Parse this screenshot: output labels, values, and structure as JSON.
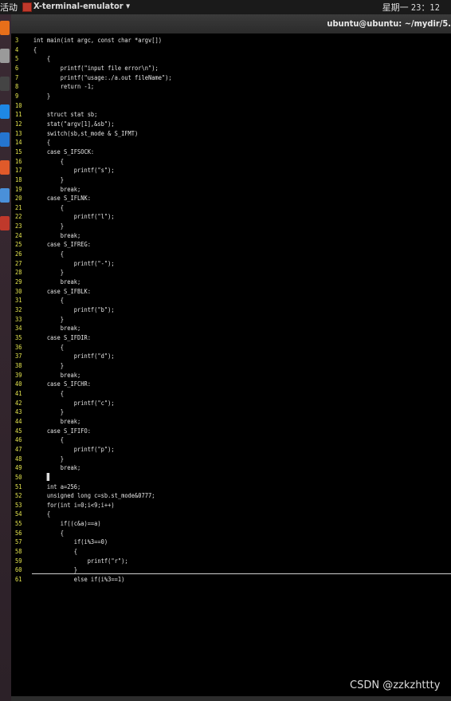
{
  "topbar": {
    "activities": "活动",
    "app_name": "X-terminal-emulator ▾",
    "clock": "星期一 23：12"
  },
  "window": {
    "title": "ubuntu@ubuntu: ~/mydir/5."
  },
  "dock": {
    "icons": [
      {
        "name": "firefox-icon",
        "color": "#e76f1a"
      },
      {
        "name": "files-icon",
        "color": "#9a9a9a"
      },
      {
        "name": "terminal-icon",
        "color": "#444444"
      },
      {
        "name": "vscode-icon",
        "color": "#1e88e5"
      },
      {
        "name": "ide-icon",
        "color": "#2575cf"
      },
      {
        "name": "software-icon",
        "color": "#e05a2a"
      },
      {
        "name": "network-icon",
        "color": "#4a90d9"
      },
      {
        "name": "app-red-icon",
        "color": "#c0392b"
      }
    ]
  },
  "code_lines": [
    {
      "n": "3",
      "t": "int main(int argc, const char *argv[])"
    },
    {
      "n": "4",
      "t": "{"
    },
    {
      "n": "5",
      "t": "    {"
    },
    {
      "n": "6",
      "t": "        printf(\"input file error\\n\");"
    },
    {
      "n": "7",
      "t": "        printf(\"usage:./a.out fileName\");"
    },
    {
      "n": "8",
      "t": "        return -1;"
    },
    {
      "n": "9",
      "t": "    }"
    },
    {
      "n": "10",
      "t": ""
    },
    {
      "n": "11",
      "t": "    struct stat sb;"
    },
    {
      "n": "12",
      "t": "    stat(\"argv[1],&sb\");"
    },
    {
      "n": "13",
      "t": "    switch(sb,st_mode & S_IFMT)"
    },
    {
      "n": "14",
      "t": "    {"
    },
    {
      "n": "15",
      "t": "    case S_IFSOCK:"
    },
    {
      "n": "16",
      "t": "        {"
    },
    {
      "n": "17",
      "t": "            printf(\"s\");"
    },
    {
      "n": "18",
      "t": "        }"
    },
    {
      "n": "19",
      "t": "        break;"
    },
    {
      "n": "20",
      "t": "    case S_IFLNK:"
    },
    {
      "n": "21",
      "t": "        {"
    },
    {
      "n": "22",
      "t": "            printf(\"l\");"
    },
    {
      "n": "23",
      "t": "        }"
    },
    {
      "n": "24",
      "t": "        break;"
    },
    {
      "n": "25",
      "t": "    case S_IFREG:"
    },
    {
      "n": "26",
      "t": "        {"
    },
    {
      "n": "27",
      "t": "            printf(\"-\");"
    },
    {
      "n": "28",
      "t": "        }"
    },
    {
      "n": "29",
      "t": "        break;"
    },
    {
      "n": "30",
      "t": "    case S_IFBLK:"
    },
    {
      "n": "31",
      "t": "        {"
    },
    {
      "n": "32",
      "t": "            printf(\"b\");"
    },
    {
      "n": "33",
      "t": "        }"
    },
    {
      "n": "34",
      "t": "        break;"
    },
    {
      "n": "35",
      "t": "    case S_IFDIR:"
    },
    {
      "n": "36",
      "t": "        {"
    },
    {
      "n": "37",
      "t": "            printf(\"d\");"
    },
    {
      "n": "38",
      "t": "        }"
    },
    {
      "n": "39",
      "t": "        break;"
    },
    {
      "n": "40",
      "t": "    case S_IFCHR:"
    },
    {
      "n": "41",
      "t": "        {"
    },
    {
      "n": "42",
      "t": "            printf(\"c\");"
    },
    {
      "n": "43",
      "t": "        }"
    },
    {
      "n": "44",
      "t": "        break;"
    },
    {
      "n": "45",
      "t": "    case S_IFIFO:"
    },
    {
      "n": "46",
      "t": "        {"
    },
    {
      "n": "47",
      "t": "            printf(\"p\");"
    },
    {
      "n": "48",
      "t": "        }"
    },
    {
      "n": "49",
      "t": "        break;"
    },
    {
      "n": "50",
      "t": "    }",
      "cursor": true
    },
    {
      "n": "51",
      "t": "    int a=256;"
    },
    {
      "n": "52",
      "t": "    unsigned long c=sb.st_mode&0777;"
    },
    {
      "n": "53",
      "t": "    for(int i=0;i<9;i++)"
    },
    {
      "n": "54",
      "t": "    {"
    },
    {
      "n": "55",
      "t": "        if((c&a)==a)"
    },
    {
      "n": "56",
      "t": "        {"
    },
    {
      "n": "57",
      "t": "            if(i%3==0)"
    },
    {
      "n": "58",
      "t": "            {"
    },
    {
      "n": "59",
      "t": "                printf(\"r\");"
    },
    {
      "n": "60",
      "t": "            }"
    },
    {
      "n": "61",
      "t": "            else if(i%3==1)"
    }
  ],
  "watermark": "CSDN @zzkzhttty"
}
